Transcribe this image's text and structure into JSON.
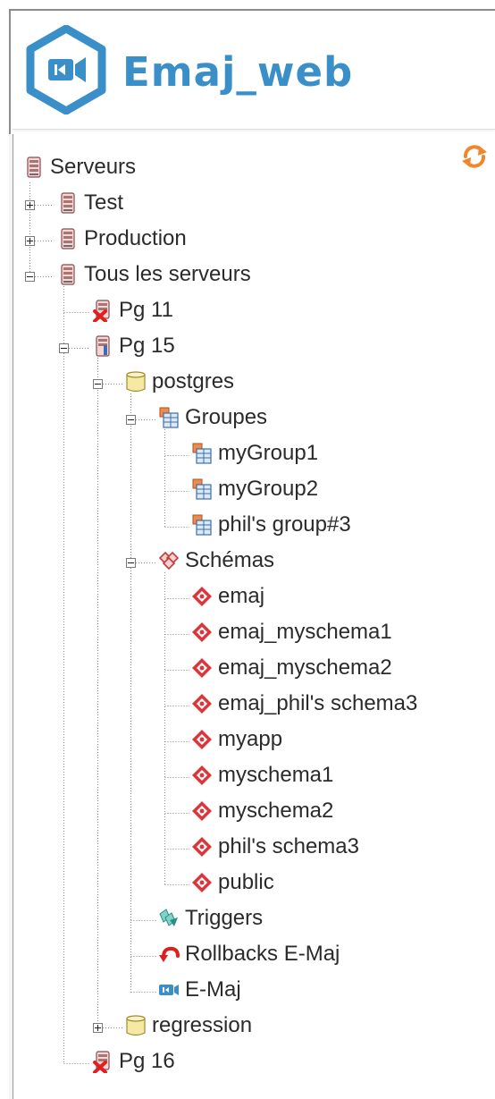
{
  "app": {
    "title": "Emaj_web",
    "logo_icon": "emaj-hexagon-camera-logo",
    "refresh_icon": "refresh-icon",
    "brand_color": "#3a8fc9",
    "accent_color": "#f0872a"
  },
  "tree": {
    "root": {
      "label": "Serveurs",
      "icon": "server-icon"
    },
    "groups": [
      {
        "label": "Test",
        "icon": "server-icon",
        "toggle": "plus"
      },
      {
        "label": "Production",
        "icon": "server-icon",
        "toggle": "plus"
      },
      {
        "label": "Tous les serveurs",
        "icon": "server-icon",
        "toggle": "minus"
      }
    ],
    "servers": [
      {
        "label": "Pg 11",
        "icon": "server-disconnected-icon"
      },
      {
        "label": "Pg 15",
        "icon": "server-connected-icon",
        "toggle": "minus"
      },
      {
        "label": "Pg 16",
        "icon": "server-disconnected-icon"
      }
    ],
    "databases": [
      {
        "label": "postgres",
        "icon": "database-icon",
        "toggle": "minus"
      },
      {
        "label": "regression",
        "icon": "database-icon",
        "toggle": "plus"
      }
    ],
    "postgres": {
      "groupes": {
        "label": "Groupes",
        "icon": "emaj-group-icon",
        "toggle": "minus"
      },
      "group_items": [
        "myGroup1",
        "myGroup2",
        "phil's group#3"
      ],
      "schemas": {
        "label": "Schémas",
        "icon": "schemas-icon",
        "toggle": "minus"
      },
      "schema_items": [
        "emaj",
        "emaj_myschema1",
        "emaj_myschema2",
        "emaj_phil's schema3",
        "myapp",
        "myschema1",
        "myschema2",
        "phil's schema3",
        "public"
      ],
      "triggers": {
        "label": "Triggers",
        "icon": "triggers-icon"
      },
      "rollbacks": {
        "label": "Rollbacks E-Maj",
        "icon": "rollback-arrow-icon"
      },
      "emaj": {
        "label": "E-Maj",
        "icon": "emaj-camera-icon"
      }
    }
  }
}
